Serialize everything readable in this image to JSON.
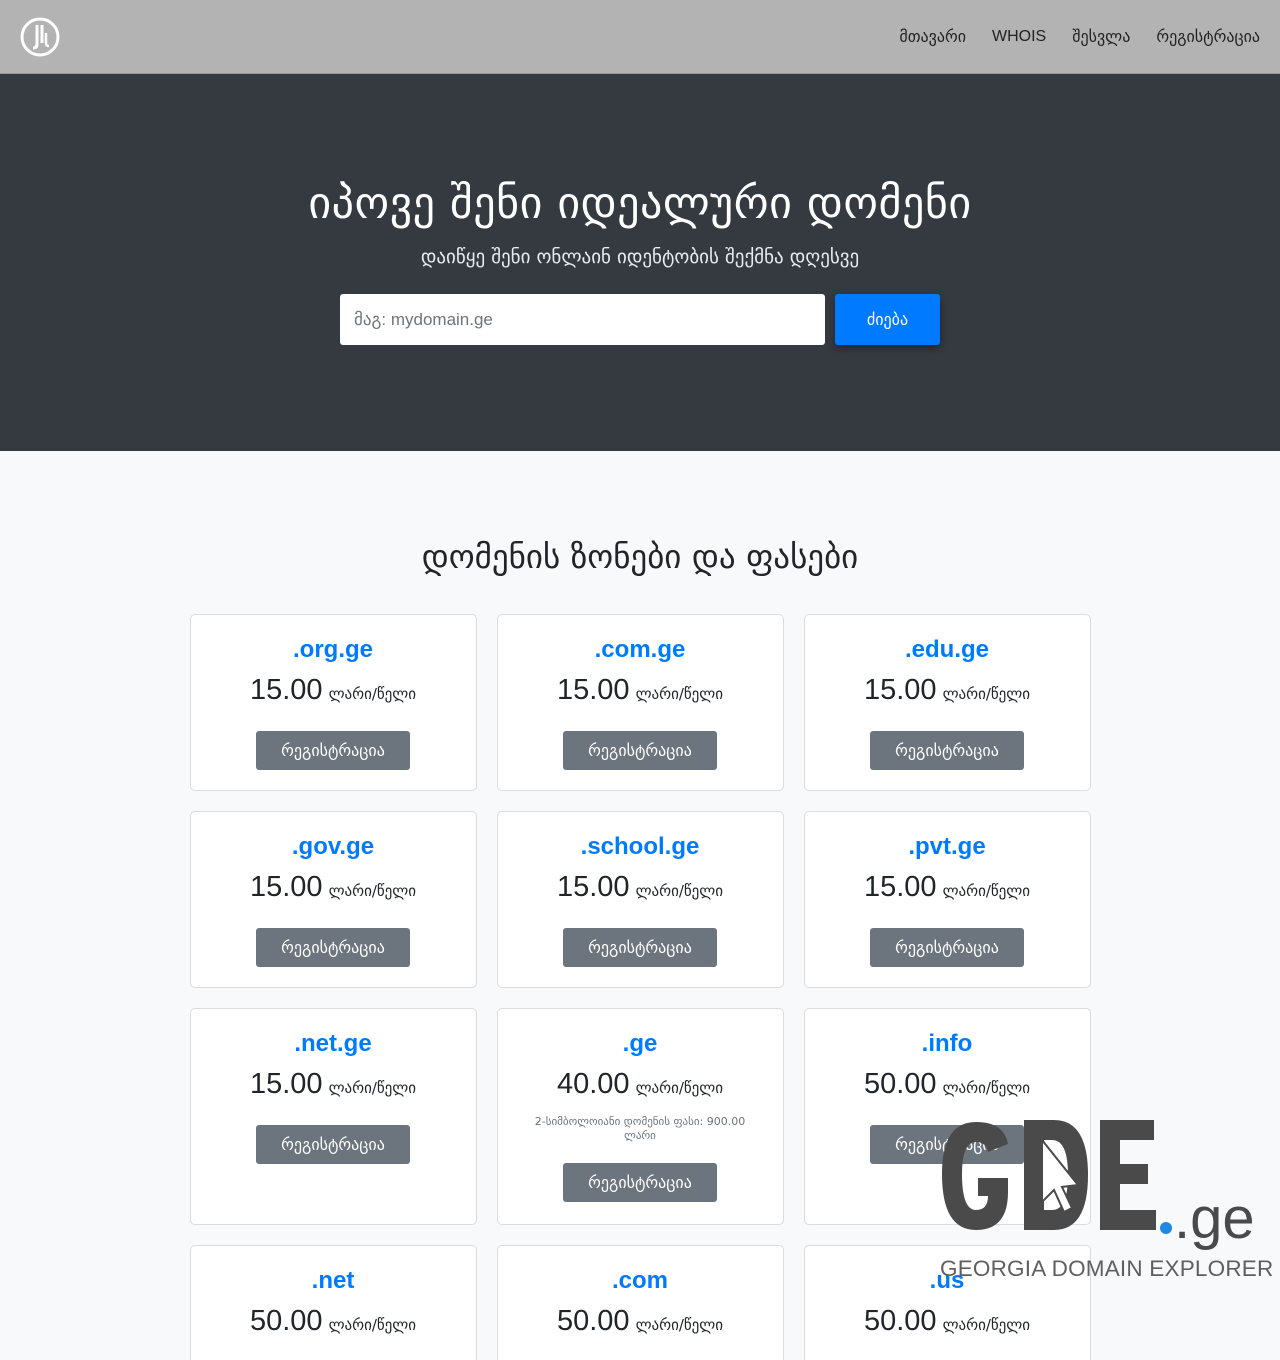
{
  "nav": {
    "links": [
      "მთავარი",
      "WHOIS",
      "შესვლა",
      "რეგისტრაცია"
    ]
  },
  "hero": {
    "title": "იპოვე შენი იდეალური დომენი",
    "subtitle": "დაიწყე შენი ონლაინ იდენტობის შექმნა დღესვე",
    "search_placeholder": "მაგ: mydomain.ge",
    "search_button": "ძიება"
  },
  "zones": {
    "title": "დომენის ზონები და ფასები",
    "unit": "ლარი/წელი",
    "register_label": "რეგისტრაცია",
    "items": [
      {
        "name": ".org.ge",
        "price": "15.00"
      },
      {
        "name": ".com.ge",
        "price": "15.00"
      },
      {
        "name": ".edu.ge",
        "price": "15.00"
      },
      {
        "name": ".gov.ge",
        "price": "15.00"
      },
      {
        "name": ".school.ge",
        "price": "15.00"
      },
      {
        "name": ".pvt.ge",
        "price": "15.00"
      },
      {
        "name": ".net.ge",
        "price": "15.00"
      },
      {
        "name": ".ge",
        "price": "40.00",
        "note": "2-სიმბოლოიანი დომენის ფასი: 900.00 ლარი"
      },
      {
        "name": ".info",
        "price": "50.00"
      },
      {
        "name": ".net",
        "price": "50.00"
      },
      {
        "name": ".com",
        "price": "50.00"
      },
      {
        "name": ".us",
        "price": "50.00"
      }
    ]
  },
  "watermark": {
    "brand": "GDE",
    "suffix": ".ge",
    "tagline": "GEORGIA DOMAIN EXPLORER"
  },
  "colors": {
    "primary": "#007bff",
    "secondary": "#6c757d",
    "hero_bg": "#343a40",
    "navbar_bg": "#b3b3b3"
  }
}
